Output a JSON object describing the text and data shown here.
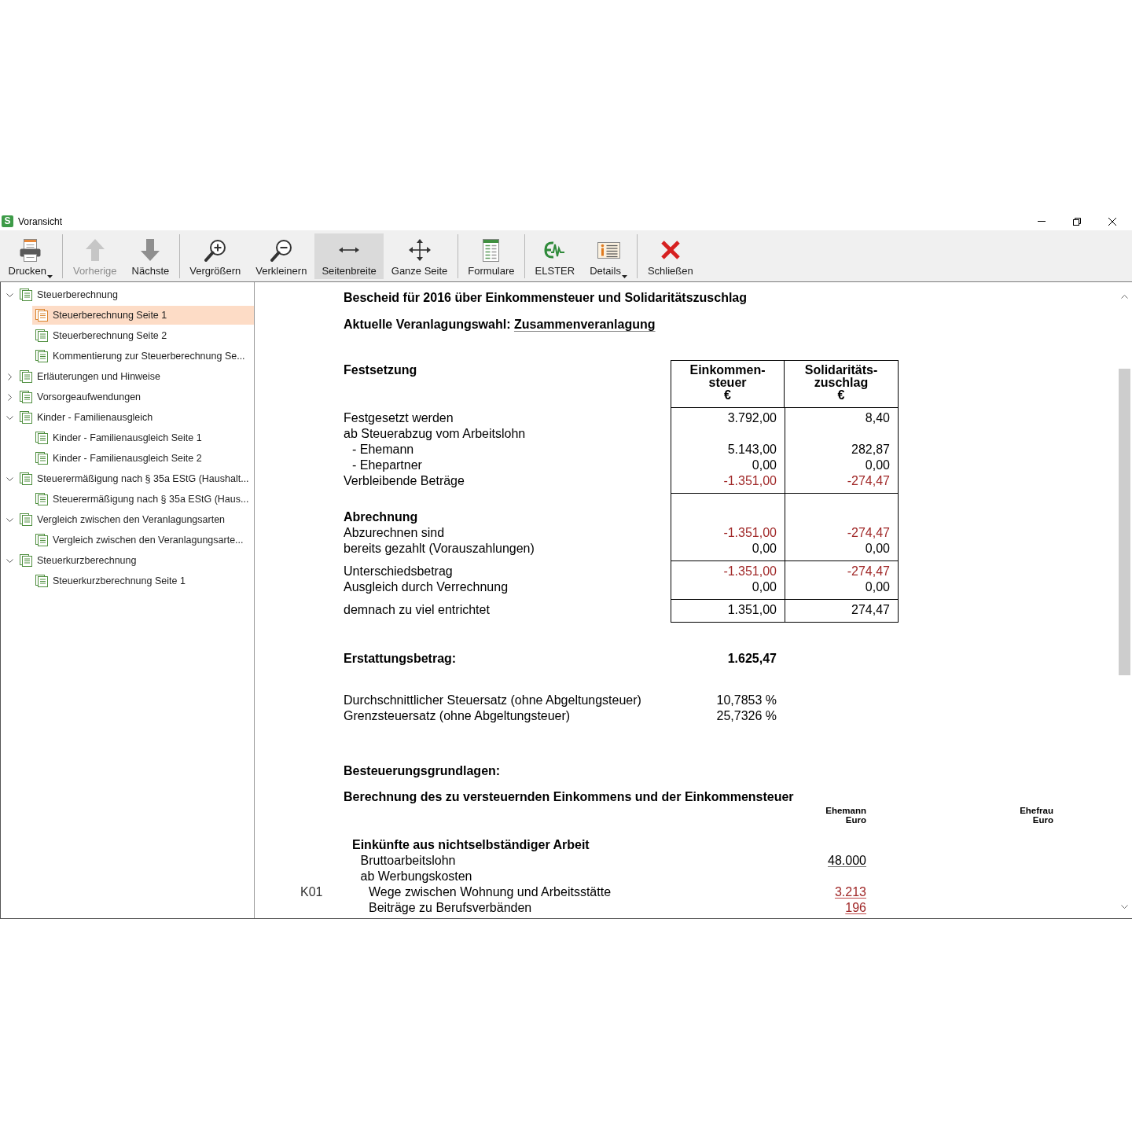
{
  "window": {
    "app_icon_letter": "S",
    "title": "Voransicht"
  },
  "toolbar": {
    "groups": [
      {
        "buttons": [
          {
            "kind": "print",
            "label": "Drucken",
            "dropdown": true,
            "disabled": false,
            "selected": false
          }
        ]
      },
      {
        "buttons": [
          {
            "kind": "previous",
            "label": "Vorherige",
            "dropdown": false,
            "disabled": true,
            "selected": false
          },
          {
            "kind": "next",
            "label": "Nächste",
            "dropdown": false,
            "disabled": false,
            "selected": false
          }
        ]
      },
      {
        "buttons": [
          {
            "kind": "zoomin",
            "label": "Vergrößern",
            "dropdown": false,
            "disabled": false,
            "selected": false
          },
          {
            "kind": "zoomout",
            "label": "Verkleinern",
            "dropdown": false,
            "disabled": false,
            "selected": false
          },
          {
            "kind": "pagewidth",
            "label": "Seitenbreite",
            "dropdown": false,
            "disabled": false,
            "selected": true
          },
          {
            "kind": "wholepage",
            "label": "Ganze Seite",
            "dropdown": false,
            "disabled": false,
            "selected": false
          }
        ]
      },
      {
        "buttons": [
          {
            "kind": "forms",
            "label": "Formulare",
            "dropdown": false,
            "disabled": false,
            "selected": false
          }
        ]
      },
      {
        "buttons": [
          {
            "kind": "elster",
            "label": "ELSTER",
            "dropdown": false,
            "disabled": false,
            "selected": false
          },
          {
            "kind": "details",
            "label": "Details",
            "dropdown": true,
            "disabled": false,
            "selected": false
          }
        ]
      },
      {
        "buttons": [
          {
            "kind": "close",
            "label": "Schließen",
            "dropdown": false,
            "disabled": false,
            "selected": false
          }
        ]
      }
    ]
  },
  "sidebar": {
    "items": [
      {
        "label": "Steuerberechnung",
        "expanded": true,
        "selected": false,
        "children": [
          {
            "label": "Steuerberechnung Seite 1",
            "selected": true
          },
          {
            "label": "Steuerberechnung Seite 2",
            "selected": false
          },
          {
            "label": "Kommentierung zur Steuerberechnung Se...",
            "selected": false
          }
        ]
      },
      {
        "label": "Erläuterungen und Hinweise",
        "expanded": false,
        "selected": false
      },
      {
        "label": "Vorsorgeaufwendungen",
        "expanded": false,
        "selected": false
      },
      {
        "label": "Kinder - Familienausgleich",
        "expanded": true,
        "selected": false,
        "children": [
          {
            "label": "Kinder - Familienausgleich Seite 1",
            "selected": false
          },
          {
            "label": "Kinder - Familienausgleich Seite 2",
            "selected": false
          }
        ]
      },
      {
        "label": "Steuerermäßigung nach § 35a EStG (Haushalt...",
        "expanded": true,
        "selected": false,
        "children": [
          {
            "label": "Steuerermäßigung nach § 35a EStG (Haus...",
            "selected": false
          }
        ]
      },
      {
        "label": "Vergleich zwischen den Veranlagungsarten",
        "expanded": true,
        "selected": false,
        "children": [
          {
            "label": "Vergleich zwischen den Veranlagungsarte...",
            "selected": false
          }
        ]
      },
      {
        "label": "Steuerkurzberechnung",
        "expanded": true,
        "selected": false,
        "children": [
          {
            "label": "Steuerkurzberechnung Seite 1",
            "selected": false
          }
        ]
      }
    ]
  },
  "document": {
    "title": "Bescheid für 2016 über Einkommensteuer und Solidaritätszuschlag",
    "assessment": {
      "label": "Aktuelle Veranlagungswahl:",
      "value": "Zusammenveranlagung"
    },
    "settlement": {
      "heading": "Festsetzung",
      "columns": [
        {
          "label": "Einkommen-\nsteuer",
          "unit": "€"
        },
        {
          "label": "Solidaritäts-\nzuschlag",
          "unit": "€"
        }
      ],
      "blocks": [
        {
          "rows": [
            {
              "kind": "line",
              "label": "Festgesetzt werden",
              "values": [
                "3.792,00",
                "8,40"
              ],
              "negative": false
            },
            {
              "kind": "line",
              "label": "ab Steuerabzug vom Arbeitslohn",
              "children": [
                {
                  "kind": "line",
                  "label": "- Ehemann",
                  "values": [
                    "5.143,00",
                    "282,87"
                  ],
                  "negative": false
                },
                {
                  "kind": "line",
                  "label": "- Ehepartner",
                  "values": [
                    "0,00",
                    "0,00"
                  ],
                  "negative": false
                }
              ]
            },
            {
              "kind": "line",
              "label": "Verbleibende Beträge",
              "values": [
                "-1.351,00",
                "-274,47"
              ],
              "negative": true
            }
          ]
        },
        {
          "rows": [
            {
              "kind": "heading",
              "label": "Abrechnung"
            },
            {
              "kind": "line",
              "label": "Abzurechnen sind",
              "values": [
                "-1.351,00",
                "-274,47"
              ],
              "negative": true
            },
            {
              "kind": "line",
              "label": "bereits gezahlt (Vorauszahlungen)",
              "values": [
                "0,00",
                "0,00"
              ],
              "negative": false
            }
          ]
        },
        {
          "rows": [
            {
              "kind": "line",
              "label": "Unterschiedsbetrag",
              "values": [
                "-1.351,00",
                "-274,47"
              ],
              "negative": true
            },
            {
              "kind": "line",
              "label": "Ausgleich durch Verrechnung",
              "values": [
                "0,00",
                "0,00"
              ],
              "negative": false
            }
          ]
        },
        {
          "rows": [
            {
              "kind": "line",
              "label": "demnach zu viel entrichtet",
              "values": [
                "1.351,00",
                "274,47"
              ],
              "negative": false
            }
          ]
        }
      ]
    },
    "refund": {
      "label": "Erstattungsbetrag:",
      "value": "1.625,47"
    },
    "rates": [
      {
        "label": "Durchschnittlicher Steuersatz (ohne Abgeltungsteuer)",
        "value": "10,7853 %"
      },
      {
        "label": "Grenzsteuersatz (ohne Abgeltungsteuer)",
        "value": "25,7326 %"
      }
    ],
    "basis": {
      "heading": "Besteuerungsgrundlagen:",
      "subheading": "Berechnung des zu versteuernden Einkommens und der Einkommensteuer",
      "columns": [
        {
          "label": "Ehemann",
          "unit": "Euro"
        },
        {
          "label": "Ehefrau",
          "unit": "Euro"
        }
      ],
      "rows": [
        {
          "kind": "heading",
          "label": "Einkünfte aus nichtselbständiger Arbeit",
          "children": [
            {
              "kind": "line",
              "label": "Bruttoarbeitslohn",
              "values": [
                "48.000"
              ],
              "negative": false
            },
            {
              "kind": "line",
              "label": "ab Werbungskosten",
              "children": [
                {
                  "kind": "line",
                  "code": "K01",
                  "label": "Wege zwischen Wohnung und Arbeitsstätte",
                  "values": [
                    "3.213"
                  ],
                  "negative": true
                },
                {
                  "kind": "line",
                  "label": "Beiträge zu Berufsverbänden",
                  "values": [
                    "196"
                  ],
                  "negative": true
                }
              ]
            }
          ]
        }
      ]
    }
  }
}
